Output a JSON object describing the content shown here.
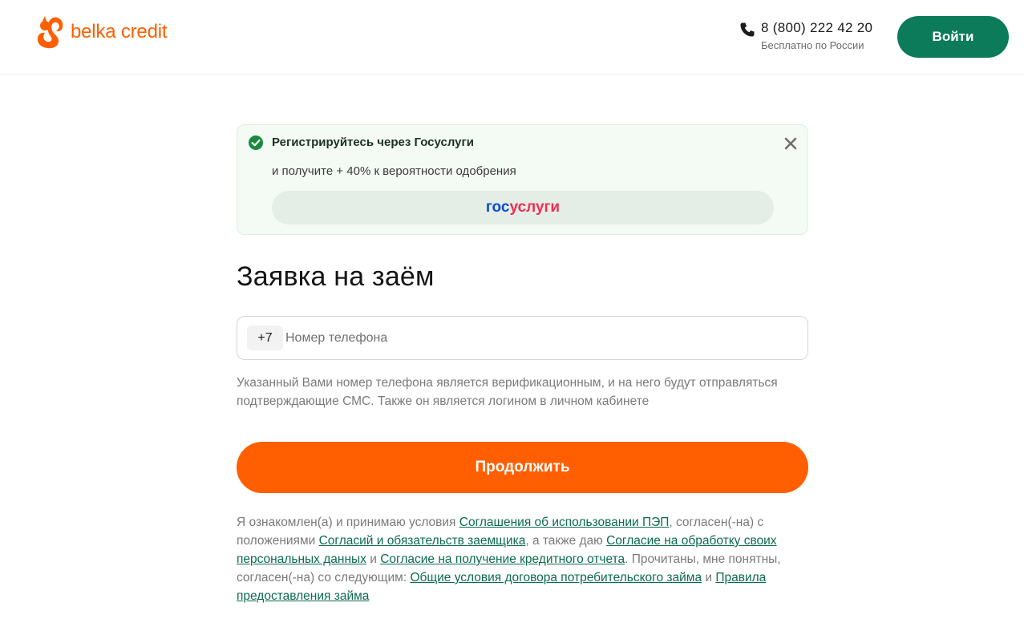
{
  "header": {
    "logo_text": "belka credit",
    "phone_number": "8 (800) 222 42 20",
    "phone_note": "Бесплатно по России",
    "login_label": "Войти"
  },
  "banner": {
    "title": "Регистрируйтесь через Госуслуги",
    "subtitle": "и получите + 40% к вероятности одобрения",
    "gos_part1": "гос",
    "gos_part2": "услуги"
  },
  "form": {
    "title": "Заявка на заём",
    "prefix": "+7",
    "phone_placeholder": "Номер телефона",
    "phone_value": "",
    "hint": "Указанный Вами номер телефона является верификационным, и на него будут отправляться подтверждающие СМС. Также он является логином в личном кабинете",
    "continue_label": "Продолжить"
  },
  "legal": {
    "t1": "Я ознакомлен(а) и принимаю условия ",
    "link1": "Соглашения об использовании ПЭП",
    "t2": ", согласен(-на) с положениями ",
    "link2": "Согласий и обязательств заемщика",
    "t3": ", а также даю ",
    "link3": "Согласие на обработку своих персональных данных",
    "t4": " и ",
    "link4": "Согласие на получение кредитного отчета",
    "t5": ". Прочитаны, мне понятны, согласен(-на) со следующим: ",
    "link5": "Общие условия договора потребительского займа",
    "t6": " и ",
    "link6": "Правила предоставления займа"
  },
  "colors": {
    "brand_orange": "#ff5f00",
    "brand_green": "#0b7b5a",
    "link_green": "#0b6b50",
    "gos_blue": "#0d4cd3",
    "gos_red": "#ee2f53"
  }
}
